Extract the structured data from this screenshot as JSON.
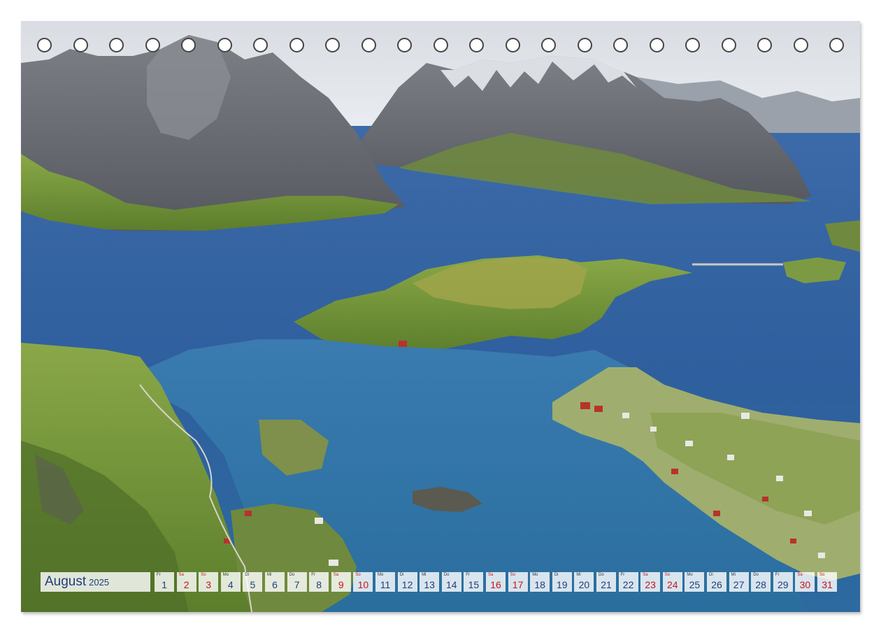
{
  "calendar": {
    "month": "August",
    "year": "2025",
    "days": [
      {
        "wd": "Fr",
        "num": "1",
        "weekend": false
      },
      {
        "wd": "Sa",
        "num": "2",
        "weekend": true
      },
      {
        "wd": "So",
        "num": "3",
        "weekend": true
      },
      {
        "wd": "Mo",
        "num": "4",
        "weekend": false
      },
      {
        "wd": "Di",
        "num": "5",
        "weekend": false
      },
      {
        "wd": "Mi",
        "num": "6",
        "weekend": false
      },
      {
        "wd": "Do",
        "num": "7",
        "weekend": false
      },
      {
        "wd": "Fr",
        "num": "8",
        "weekend": false
      },
      {
        "wd": "Sa",
        "num": "9",
        "weekend": true
      },
      {
        "wd": "So",
        "num": "10",
        "weekend": true
      },
      {
        "wd": "Mo",
        "num": "11",
        "weekend": false
      },
      {
        "wd": "Di",
        "num": "12",
        "weekend": false
      },
      {
        "wd": "Mi",
        "num": "13",
        "weekend": false
      },
      {
        "wd": "Do",
        "num": "14",
        "weekend": false
      },
      {
        "wd": "Fr",
        "num": "15",
        "weekend": false
      },
      {
        "wd": "Sa",
        "num": "16",
        "weekend": true
      },
      {
        "wd": "So",
        "num": "17",
        "weekend": true
      },
      {
        "wd": "Mo",
        "num": "18",
        "weekend": false
      },
      {
        "wd": "Di",
        "num": "19",
        "weekend": false
      },
      {
        "wd": "Mi",
        "num": "20",
        "weekend": false
      },
      {
        "wd": "Do",
        "num": "21",
        "weekend": false
      },
      {
        "wd": "Fr",
        "num": "22",
        "weekend": false
      },
      {
        "wd": "Sa",
        "num": "23",
        "weekend": true
      },
      {
        "wd": "So",
        "num": "24",
        "weekend": true
      },
      {
        "wd": "Mo",
        "num": "25",
        "weekend": false
      },
      {
        "wd": "Di",
        "num": "26",
        "weekend": false
      },
      {
        "wd": "Mi",
        "num": "27",
        "weekend": false
      },
      {
        "wd": "Do",
        "num": "28",
        "weekend": false
      },
      {
        "wd": "Fr",
        "num": "29",
        "weekend": false
      },
      {
        "wd": "Sa",
        "num": "30",
        "weekend": true
      },
      {
        "wd": "So",
        "num": "31",
        "weekend": true
      }
    ]
  },
  "binding_holes": 23,
  "colors": {
    "weekday": "#1f3d7a",
    "weekend": "#c4161c",
    "water": "#2f5f9e",
    "mountain": "#6b6e76",
    "grass": "#6f9a3a"
  }
}
